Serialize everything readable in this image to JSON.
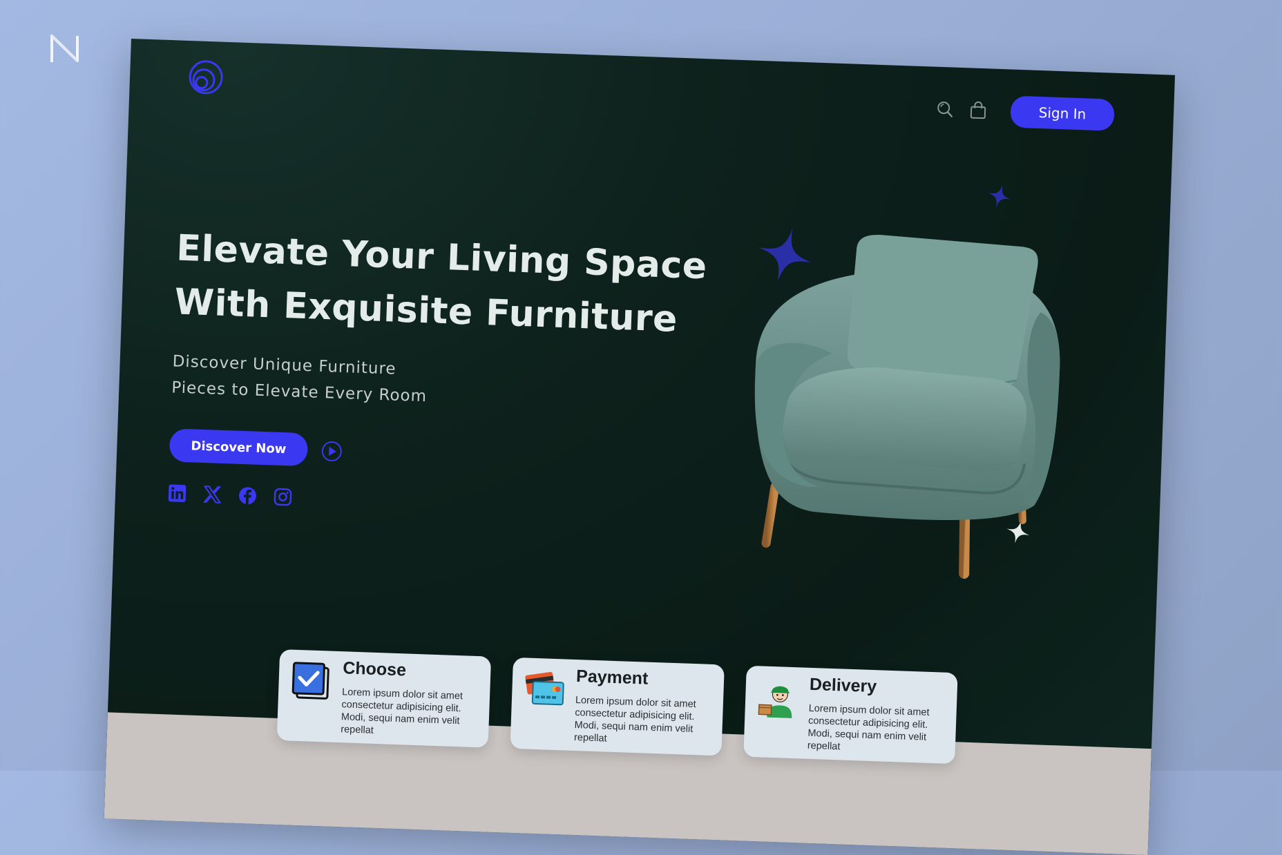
{
  "nav": {
    "search_icon": "search-icon",
    "cart_icon": "shopping-bag-icon",
    "sign_in_label": "Sign In"
  },
  "hero": {
    "headline_line1": "Elevate Your Living Space",
    "headline_line2": "With Exquisite Furniture",
    "subtitle_line1": "Discover Unique Furniture",
    "subtitle_line2": "Pieces to Elevate Every Room",
    "cta_label": "Discover Now",
    "play_icon": "play-icon"
  },
  "socials": [
    "linkedin-icon",
    "x-icon",
    "facebook-icon",
    "instagram-icon"
  ],
  "features": [
    {
      "title": "Choose",
      "text": "Lorem ipsum dolor sit amet consectetur adipisicing elit. Modi, sequi nam enim velit repellat",
      "icon": "checkbox-icon"
    },
    {
      "title": "Payment",
      "text": "Lorem ipsum dolor sit amet consectetur adipisicing elit. Modi, sequi nam enim velit repellat",
      "icon": "credit-card-icon"
    },
    {
      "title": "Delivery",
      "text": "Lorem ipsum dolor sit amet consectetur adipisicing elit. Modi, sequi nam enim velit repellat",
      "icon": "delivery-person-icon"
    }
  ],
  "colors": {
    "accent": "#3a38f0",
    "background": "#0d201b",
    "card": "#dde6ec",
    "chair": "#6e9590"
  }
}
